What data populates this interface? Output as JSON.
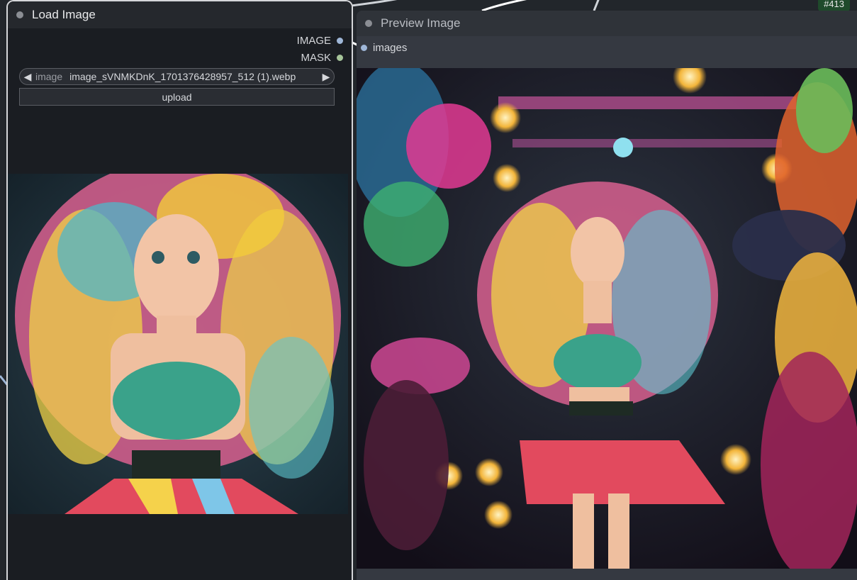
{
  "load_node": {
    "title": "Load Image",
    "outputs": [
      {
        "label": "IMAGE",
        "color": "#9fb7d8"
      },
      {
        "label": "MASK",
        "color": "#a6c49a"
      }
    ],
    "image_widget": {
      "label": "image",
      "value": "image_sVNMKDnK_1701376428957_512 (1).webp"
    },
    "upload_label": "upload"
  },
  "preview_node": {
    "title": "Preview Image",
    "input_label": "images"
  },
  "badge": "#413",
  "colors": {
    "node_bg": "#353941",
    "load_bg": "#1a1d22",
    "accent_selected": "#d6d7da"
  }
}
